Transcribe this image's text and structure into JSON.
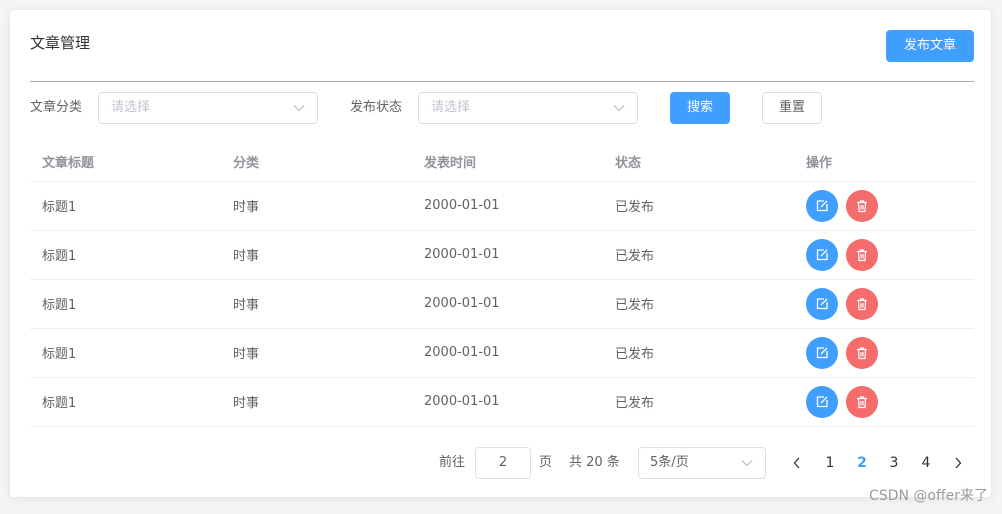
{
  "header": {
    "title": "文章管理",
    "publish_label": "发布文章"
  },
  "filters": {
    "category_label": "文章分类",
    "category_placeholder": "请选择",
    "status_label": "发布状态",
    "status_placeholder": "请选择",
    "search_label": "搜索",
    "reset_label": "重置"
  },
  "table": {
    "columns": [
      "文章标题",
      "分类",
      "发表时间",
      "状态",
      "操作"
    ],
    "rows": [
      {
        "title": "标题1",
        "category": "时事",
        "date": "2000-01-01",
        "status": "已发布"
      },
      {
        "title": "标题1",
        "category": "时事",
        "date": "2000-01-01",
        "status": "已发布"
      },
      {
        "title": "标题1",
        "category": "时事",
        "date": "2000-01-01",
        "status": "已发布"
      },
      {
        "title": "标题1",
        "category": "时事",
        "date": "2000-01-01",
        "status": "已发布"
      },
      {
        "title": "标题1",
        "category": "时事",
        "date": "2000-01-01",
        "status": "已发布"
      }
    ],
    "action_icons": [
      "edit-icon",
      "delete-icon"
    ]
  },
  "pagination": {
    "goto_prefix": "前往",
    "goto_value": "2",
    "goto_suffix": "页",
    "total_text": "共 20 条",
    "page_size": "5条/页",
    "pages": [
      "1",
      "2",
      "3",
      "4"
    ],
    "current_page": "2",
    "prev_icon": "chevron-left-icon",
    "next_icon": "chevron-right-icon"
  },
  "watermark": "CSDN @offer来了",
  "colors": {
    "primary": "#409eff",
    "danger": "#f56c6c",
    "text": "#606266",
    "header_text": "#909399"
  }
}
